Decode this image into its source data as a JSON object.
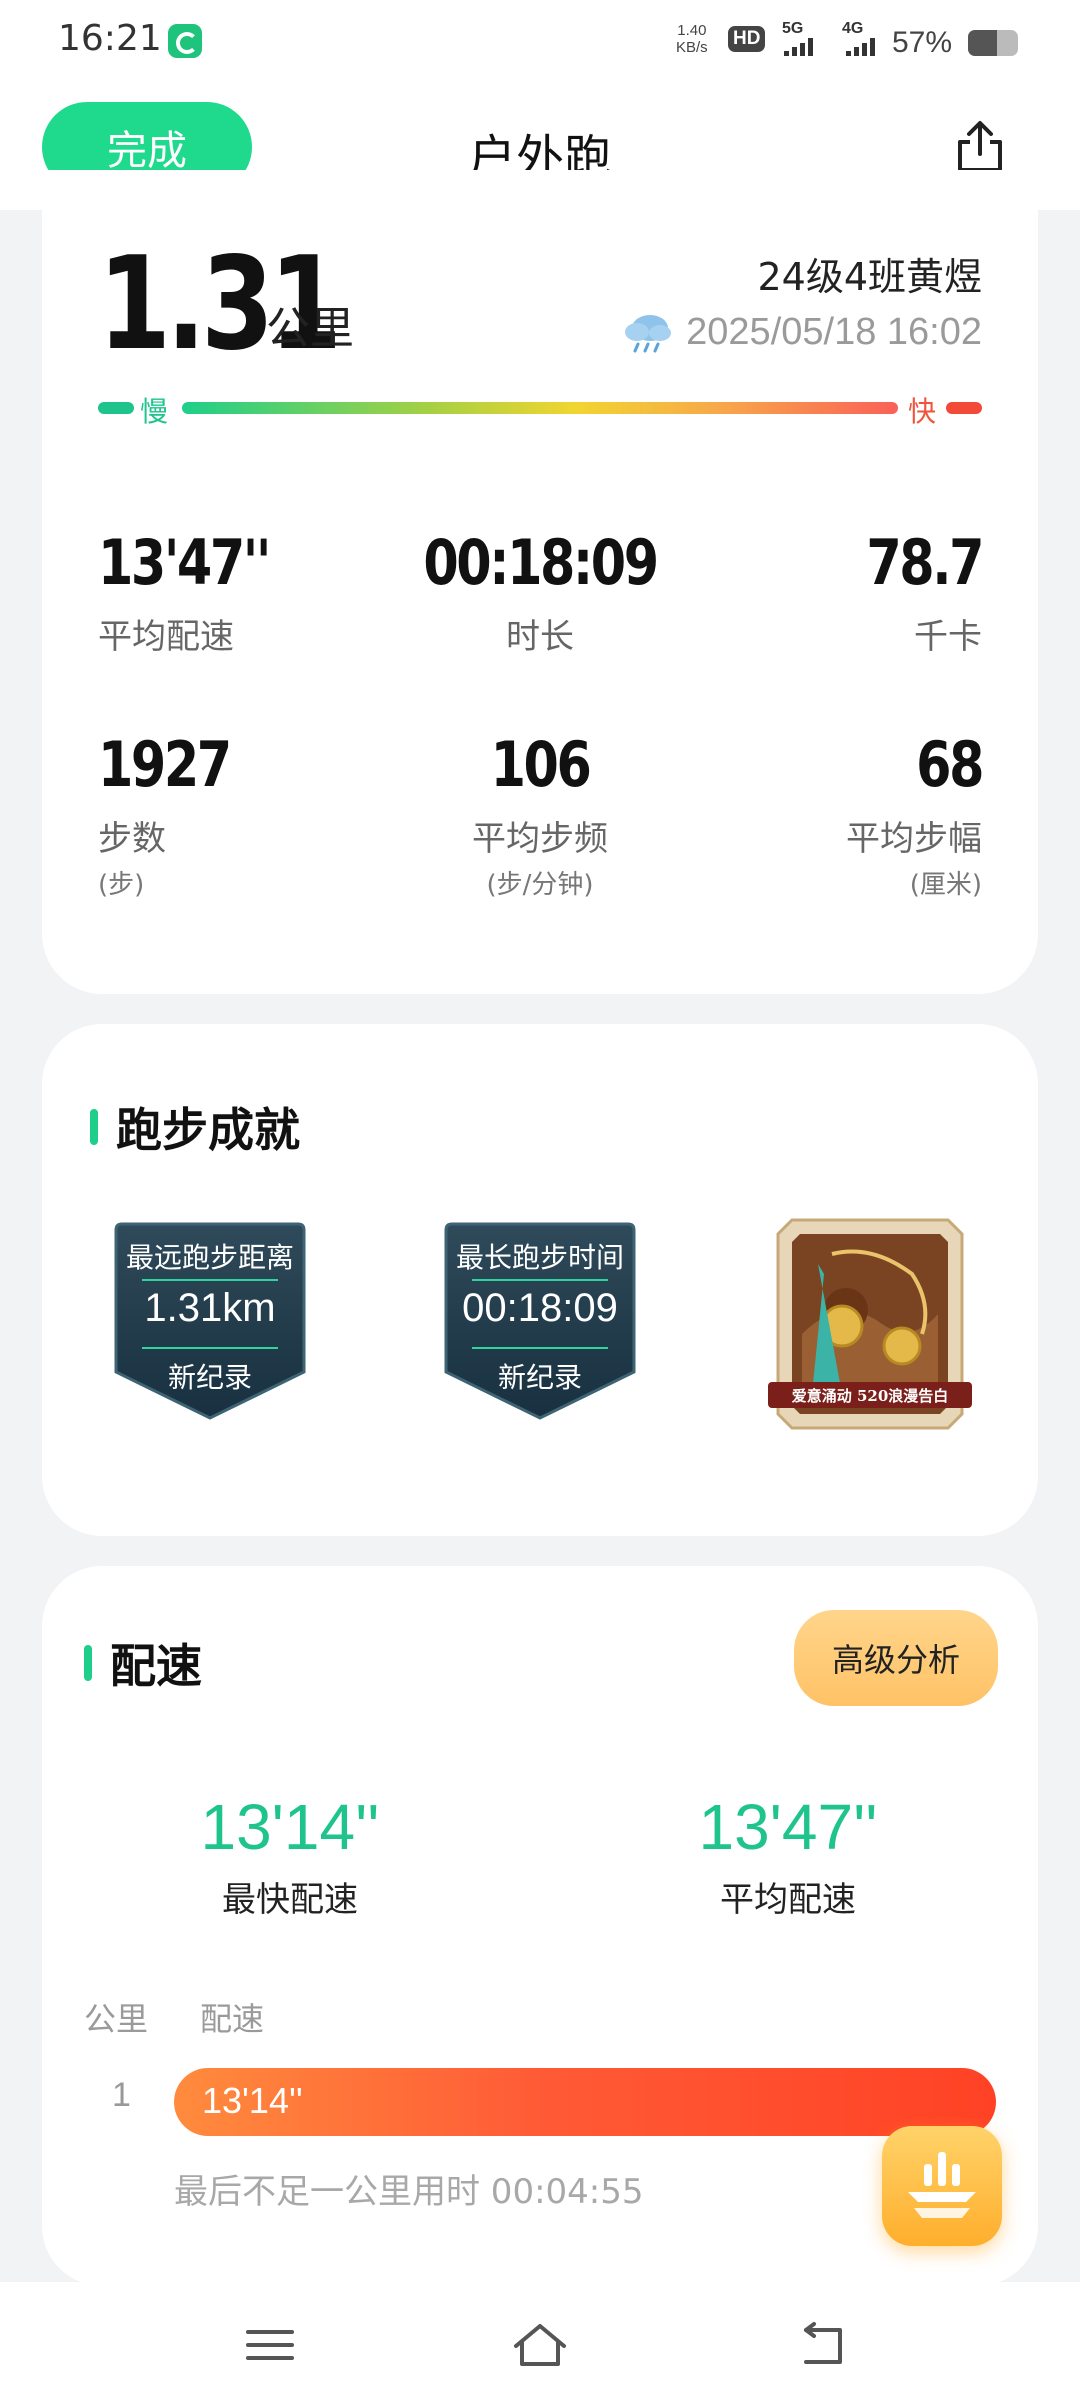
{
  "status_bar": {
    "time": "16:21",
    "net_rate_value": "1.40",
    "net_rate_unit": "KB/s",
    "hd_label": "HD",
    "net_1": "5G",
    "net_2": "4G",
    "battery_text": "57%",
    "battery_level": 0.57
  },
  "top_bar": {
    "done_label": "完成",
    "title": "户外跑"
  },
  "summary": {
    "distance_value": "1.31",
    "distance_unit": "公里",
    "user_name": "24级4班黄煜",
    "datetime": "2025/05/18 16:02",
    "speed_slow": "慢",
    "speed_fast": "快"
  },
  "stats": [
    {
      "value": "13'47''",
      "label": "平均配速",
      "sub": ""
    },
    {
      "value": "00:18:09",
      "label": "时长",
      "sub": ""
    },
    {
      "value": "78.7",
      "label": "千卡",
      "sub": ""
    },
    {
      "value": "1927",
      "label": "步数",
      "sub": "(步)"
    },
    {
      "value": "106",
      "label": "平均步频",
      "sub": "(步/分钟)"
    },
    {
      "value": "68",
      "label": "平均步幅",
      "sub": "(厘米)"
    }
  ],
  "achievements": {
    "title": "跑步成就",
    "badges": [
      {
        "title": "最远跑步距离",
        "value": "1.31km",
        "record": "新纪录"
      },
      {
        "title": "最长跑步时间",
        "value": "00:18:09",
        "record": "新纪录"
      }
    ],
    "promo_text": "爱意涌动 520浪漫告白"
  },
  "pace": {
    "title": "配速",
    "advanced_label": "高级分析",
    "fastest_value": "13'14''",
    "fastest_label": "最快配速",
    "average_value": "13'47''",
    "average_label": "平均配速",
    "col_km": "公里",
    "col_pace": "配速",
    "rows": [
      {
        "km": "1",
        "pace": "13'14''"
      }
    ],
    "note": "最后不足一公里用时 00:04:55"
  },
  "colors": {
    "accent_green": "#1fd98c",
    "pace_orange": "#ff5a36",
    "advanced_yellow": "#ffc266"
  },
  "icons": [
    "share-icon",
    "cloud-rain-icon",
    "menu-icon",
    "home-icon",
    "back-icon",
    "chart-float-icon"
  ]
}
